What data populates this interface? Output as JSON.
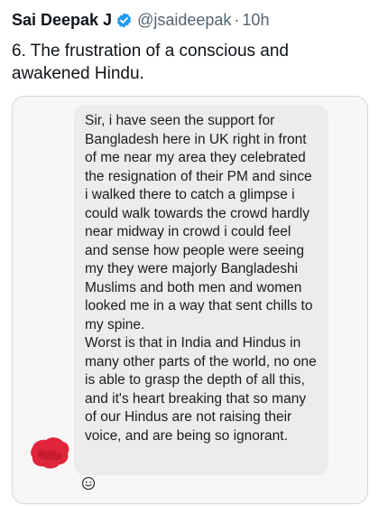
{
  "tweet": {
    "author_name": "Sai Deepak J",
    "handle": "@jsaideepak",
    "separator": "·",
    "time": "10h",
    "text": "6. The frustration of a conscious and\nawakened Hindu."
  },
  "media": {
    "message_text": "Sir, i have seen the support for\nBangladesh here in UK right in front\nof me near my area they celebrated\nthe resignation of their PM and since\ni walked there to catch a glimpse i\ncould walk towards the crowd hardly\nnear midway in crowd i could feel\nand sense how people were seeing\nmy they were majorly Bangladeshi\nMuslims and both men and women\nlooked me in a way that sent chills to\nmy spine.\nWorst is that in India and Hindus in\nmany other parts of the world, no one\nis able to grasp the depth of all this,\nand it's heart breaking that so many\nof our Hindus are not raising their\nvoice, and are being so ignorant.",
    "avatar_icon": "redacted-avatar-icon",
    "reaction_icon": "add-emoji-reaction-icon"
  },
  "colors": {
    "verified": "#1d9bf0",
    "secondary_text": "#536471",
    "bubble": "#ececec",
    "redaction": "#e0253a"
  }
}
